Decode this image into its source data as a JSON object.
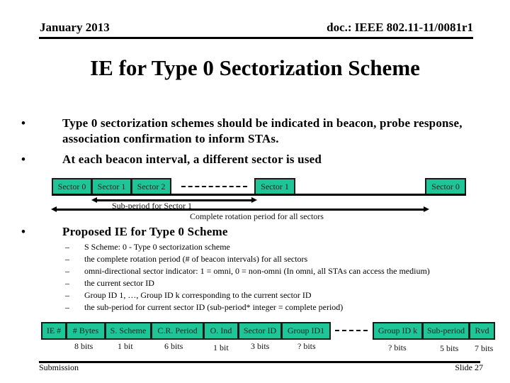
{
  "header": {
    "date": "January 2013",
    "doc_id": "doc.: IEEE 802.11-11/0081r1"
  },
  "title": "IE for Type 0 Sectorization Scheme",
  "bullets": [
    {
      "symbol": "•",
      "text": "Type 0 sectorization schemes should be indicated in beacon, probe response, association confirmation to inform STAs."
    },
    {
      "symbol": "•",
      "text": "At each beacon interval, a different sector is used"
    },
    {
      "symbol": "•",
      "text": "Proposed IE for Type 0 Scheme"
    }
  ],
  "sector_diagram": {
    "boxes": [
      "Sector 0",
      "Sector 1",
      "Sector 2",
      "Sector 1",
      "Sector 0"
    ],
    "subperiod_label": "Sub-period for Sector 1",
    "complete_label": "Complete rotation period for all sectors",
    "box_color": "#1ec697"
  },
  "sub_bullets": {
    "symbol": "–",
    "items": [
      "S Scheme: 0 - Type 0 sectorization scheme",
      "the complete rotation period (# of beacon intervals) for all sectors",
      "omni-directional sector indicator: 1 = omni, 0 = non-omni (In omni, all STAs can access the medium)",
      "the current sector ID",
      "Group ID 1, …, Group ID k corresponding to the current sector ID",
      "the sub-period for current sector ID (sub-period* integer = complete period)"
    ]
  },
  "ie_fields": [
    {
      "label": "IE #",
      "bits": ""
    },
    {
      "label": "# Bytes",
      "bits": "8 bits"
    },
    {
      "label": "S. Scheme",
      "bits": "1 bit"
    },
    {
      "label": "C.R. Period",
      "bits": "6 bits"
    },
    {
      "label": "O. Ind",
      "bits": "1 bit"
    },
    {
      "label": "Sector ID",
      "bits": "3 bits"
    },
    {
      "label": "Group ID1",
      "bits": "? bits"
    },
    {
      "label": "Group ID k",
      "bits": "? bits"
    },
    {
      "label": "Sub-period",
      "bits": "5 bits"
    },
    {
      "label": "Rvd",
      "bits": "7 bits"
    }
  ],
  "footer": {
    "left": "Submission",
    "right": "Slide 27"
  }
}
